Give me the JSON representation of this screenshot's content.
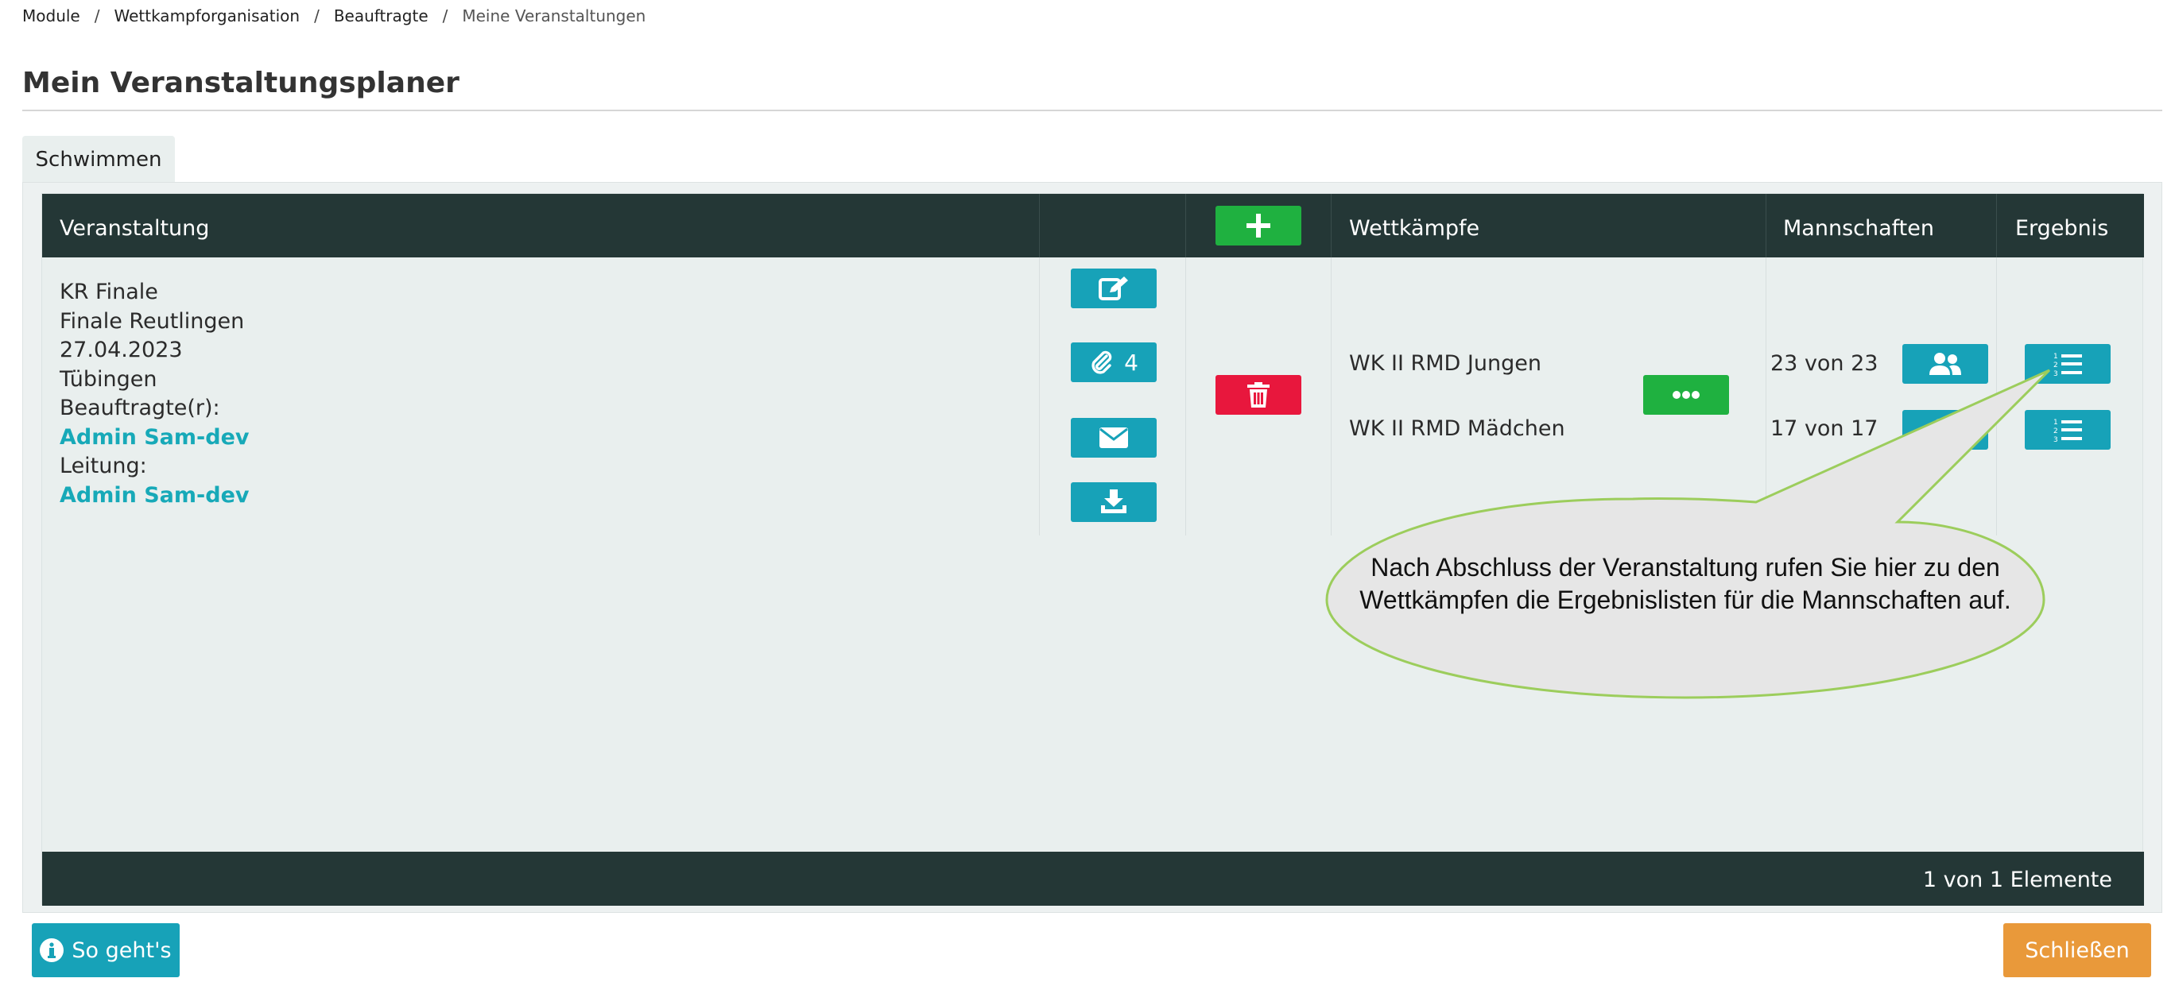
{
  "breadcrumb": {
    "items": [
      "Module",
      "Wettkampforganisation",
      "Beauftragte"
    ],
    "current": "Meine Veranstaltungen",
    "separator": "/"
  },
  "page": {
    "title": "Mein Veranstaltungsplaner"
  },
  "tabs": [
    {
      "label": "Schwimmen",
      "active": true
    }
  ],
  "table": {
    "headers": {
      "veranstaltung": "Veranstaltung",
      "wettkaempfe": "Wettkämpfe",
      "mannschaften": "Mannschaften",
      "ergebnis": "Ergebnis"
    },
    "row": {
      "lines": [
        "KR Finale",
        "Finale Reutlingen",
        "27.04.2023",
        "Tübingen",
        "Beauftragte(r):"
      ],
      "beauftragte": "Admin Sam-dev",
      "leitung_label": "Leitung:",
      "leitung": "Admin Sam-dev",
      "attachments_count": "4",
      "wettkaempfe": [
        {
          "name": "WK II RMD Jungen",
          "mannschaften": "23 von 23"
        },
        {
          "name": "WK II RMD Mädchen",
          "mannschaften": "17 von 17"
        }
      ]
    },
    "footer": {
      "count": "1 von 1 Elemente"
    }
  },
  "buttons": {
    "help": "So geht's",
    "close": "Schließen"
  },
  "callout": {
    "text": "Nach Abschluss der Veranstaltung rufen Sie hier zu den Wettkämpfen die Ergebnislisten für die Mannschaften auf."
  },
  "colors": {
    "header_bg": "#243736",
    "teal": "#17a2b8",
    "green": "#1fb140",
    "red": "#e8173d",
    "orange": "#e9993a",
    "link": "#17a9b8"
  },
  "icons": [
    "plus-icon",
    "edit-icon",
    "paperclip-icon",
    "envelope-icon",
    "download-icon",
    "trash-icon",
    "ellipsis-icon",
    "users-icon",
    "list-ordered-icon",
    "info-icon"
  ]
}
